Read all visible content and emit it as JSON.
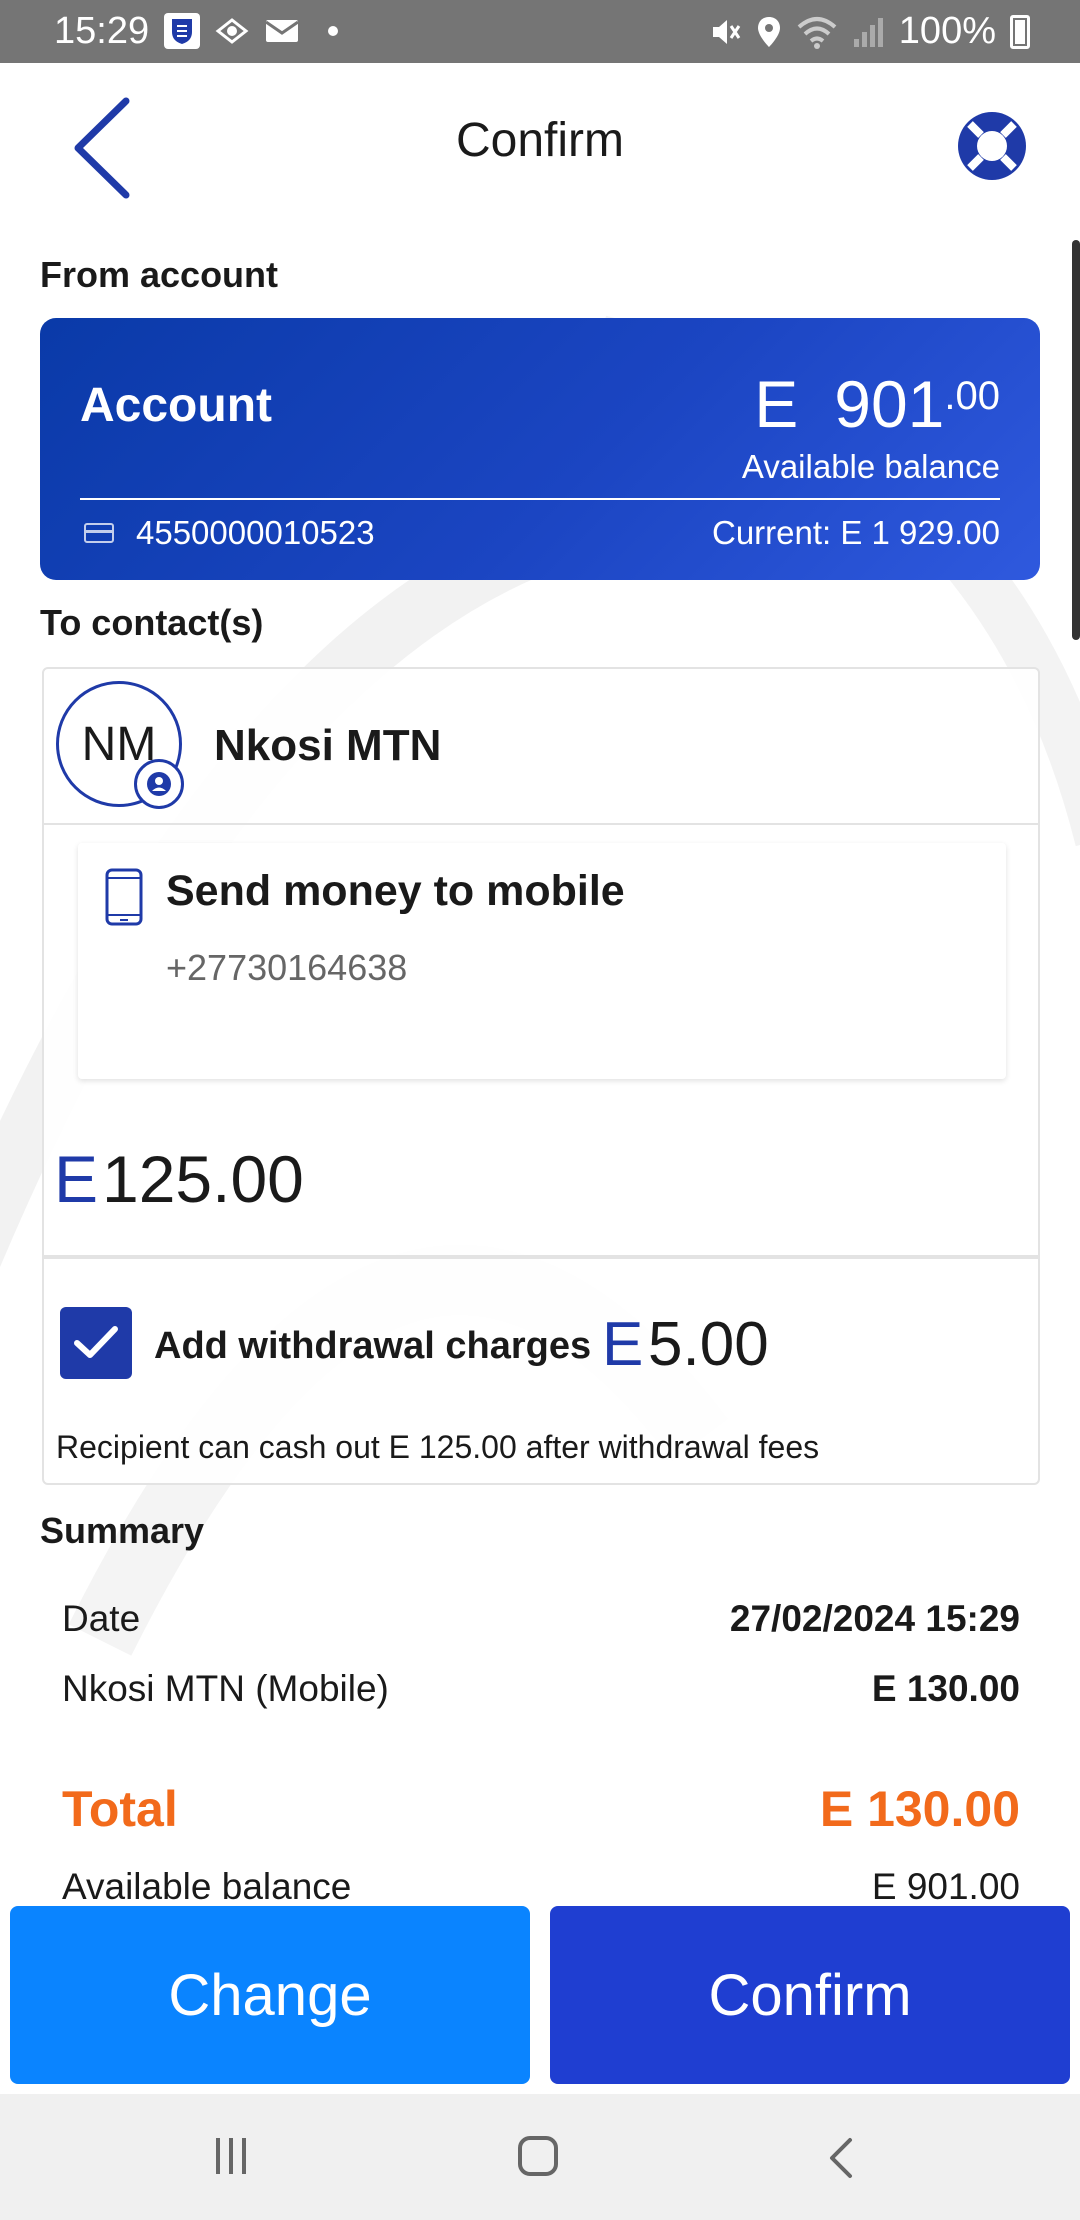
{
  "status_bar": {
    "time": "15:29",
    "battery": "100%",
    "icons": [
      "standard-bank-app-icon",
      "app-icon",
      "mail-icon",
      "dot-icon",
      "mute-icon",
      "location-icon",
      "wifi-icon",
      "signal-icon",
      "battery-icon"
    ]
  },
  "header": {
    "title": "Confirm",
    "back_icon": "chevron-left-icon",
    "help_icon": "lifebuoy-icon"
  },
  "from_account": {
    "label": "From account",
    "name": "Account",
    "currency": "E",
    "balance_main": "901",
    "balance_cents": ".00",
    "available_label": "Available balance",
    "account_number": "4550000010523",
    "current": "Current: E 1 929.00"
  },
  "to_contact": {
    "label": "To contact(s)",
    "initials": "NM",
    "name": "Nkosi MTN",
    "method_title": "Send money to mobile",
    "phone": "+27730164638",
    "amount_currency": "E",
    "amount": "125.00",
    "charges_checked": true,
    "charges_label": "Add withdrawal charges",
    "charges_currency": "E",
    "charges_amount": "5.00",
    "cashout_note": "Recipient can cash out E 125.00 after withdrawal fees"
  },
  "summary": {
    "label": "Summary",
    "date_label": "Date",
    "date_value": "27/02/2024 15:29",
    "recipient_label": "Nkosi MTN (Mobile)",
    "recipient_value": "E 130.00",
    "total_label": "Total",
    "total_value": "E 130.00",
    "available_label": "Available balance",
    "available_value": "E 901.00"
  },
  "buttons": {
    "change": "Change",
    "confirm": "Confirm"
  },
  "colors": {
    "primary_blue": "#1f3ed1",
    "light_blue": "#0a84ff",
    "card_blue": "#1b45c2",
    "accent_orange": "#f26a1b"
  }
}
